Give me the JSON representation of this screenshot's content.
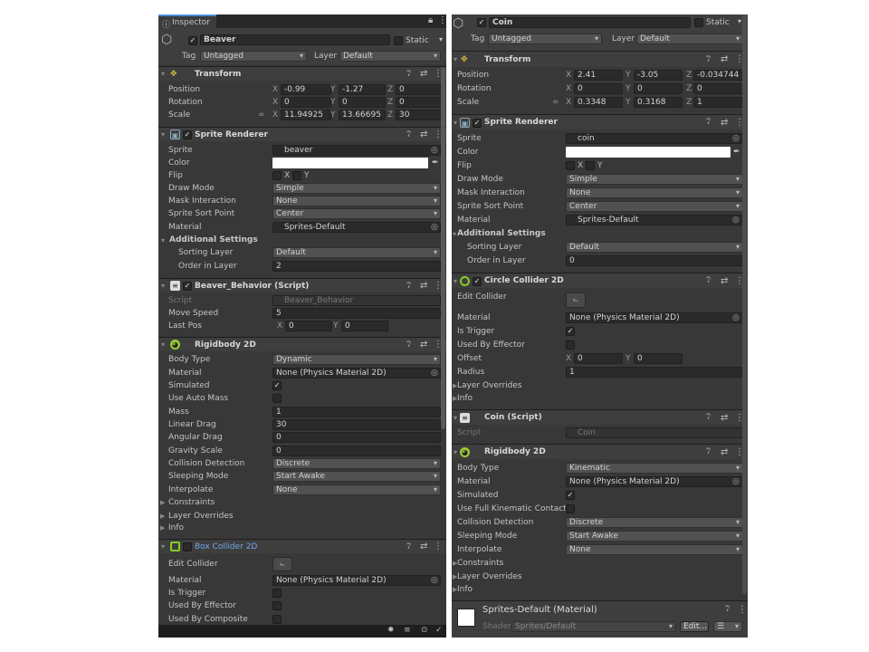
{
  "left": {
    "tab": "Inspector",
    "object": {
      "name": "Beaver",
      "static": "Static",
      "tag_label": "Tag",
      "tag": "Untagged",
      "layer_label": "Layer",
      "layer": "Default"
    },
    "transform": {
      "title": "Transform",
      "position": "Position",
      "rotation": "Rotation",
      "scale": "Scale",
      "px": "-0.99",
      "py": "-1.27",
      "pz": "0",
      "rx": "0",
      "ry": "0",
      "rz": "0",
      "sx": "11.94925",
      "sy": "13.66695",
      "sz": "30"
    },
    "sprite_renderer": {
      "title": "Sprite Renderer",
      "sprite_l": "Sprite",
      "sprite": "beaver",
      "color_l": "Color",
      "flip_l": "Flip",
      "draw_l": "Draw Mode",
      "draw": "Simple",
      "mask_l": "Mask Interaction",
      "mask": "None",
      "sort_l": "Sprite Sort Point",
      "sort": "Center",
      "mat_l": "Material",
      "mat": "Sprites-Default",
      "add_l": "Additional Settings",
      "slayer_l": "Sorting Layer",
      "slayer": "Default",
      "order_l": "Order in Layer",
      "order": "2"
    },
    "script": {
      "title": "Beaver_Behavior (Script)",
      "script_l": "Script",
      "script": "Beaver_Behavior",
      "speed_l": "Move Speed",
      "speed": "5",
      "last_l": "Last Pos",
      "lx": "0",
      "ly": "0"
    },
    "rigidbody": {
      "title": "Rigidbody 2D",
      "body_l": "Body Type",
      "body": "Dynamic",
      "mat_l": "Material",
      "mat": "None (Physics Material 2D)",
      "sim_l": "Simulated",
      "auto_l": "Use Auto Mass",
      "mass_l": "Mass",
      "mass": "1",
      "ldrag_l": "Linear Drag",
      "ldrag": "30",
      "adrag_l": "Angular Drag",
      "adrag": "0",
      "grav_l": "Gravity Scale",
      "grav": "0",
      "coll_l": "Collision Detection",
      "coll": "Discrete",
      "sleep_l": "Sleeping Mode",
      "sleep": "Start Awake",
      "interp_l": "Interpolate",
      "interp": "None",
      "cons_l": "Constraints",
      "lo_l": "Layer Overrides",
      "info_l": "Info"
    },
    "box": {
      "title": "Box Collider 2D",
      "edit_l": "Edit Collider",
      "mat_l": "Material",
      "mat": "None (Physics Material 2D)",
      "trig_l": "Is Trigger",
      "eff_l": "Used By Effector",
      "comp_l": "Used By Composite"
    }
  },
  "right": {
    "object": {
      "name": "Coin",
      "static": "Static",
      "tag_label": "Tag",
      "tag": "Untagged",
      "layer_label": "Layer",
      "layer": "Default"
    },
    "transform": {
      "title": "Transform",
      "position": "Position",
      "rotation": "Rotation",
      "scale": "Scale",
      "px": "2.41",
      "py": "-3.05",
      "pz": "-0.034744",
      "rx": "0",
      "ry": "0",
      "rz": "0",
      "sx": "0.3348",
      "sy": "0.3168",
      "sz": "1"
    },
    "sprite_renderer": {
      "title": "Sprite Renderer",
      "sprite_l": "Sprite",
      "sprite": "coin",
      "color_l": "Color",
      "flip_l": "Flip",
      "draw_l": "Draw Mode",
      "draw": "Simple",
      "mask_l": "Mask Interaction",
      "mask": "None",
      "sort_l": "Sprite Sort Point",
      "sort": "Center",
      "mat_l": "Material",
      "mat": "Sprites-Default",
      "add_l": "Additional Settings",
      "slayer_l": "Sorting Layer",
      "slayer": "Default",
      "order_l": "Order in Layer",
      "order": "0"
    },
    "circle": {
      "title": "Circle Collider 2D",
      "edit_l": "Edit Collider",
      "mat_l": "Material",
      "mat": "None (Physics Material 2D)",
      "trig_l": "Is Trigger",
      "eff_l": "Used By Effector",
      "off_l": "Offset",
      "ox": "0",
      "oy": "0",
      "rad_l": "Radius",
      "rad": "1",
      "lo_l": "Layer Overrides",
      "info_l": "Info"
    },
    "script": {
      "title": "Coin (Script)",
      "script_l": "Script",
      "script": "Coin"
    },
    "rigidbody": {
      "title": "Rigidbody 2D",
      "body_l": "Body Type",
      "body": "Kinematic",
      "mat_l": "Material",
      "mat": "None (Physics Material 2D)",
      "sim_l": "Simulated",
      "full_l": "Use Full Kinematic Contacts",
      "coll_l": "Collision Detection",
      "coll": "Discrete",
      "sleep_l": "Sleeping Mode",
      "sleep": "Start Awake",
      "interp_l": "Interpolate",
      "interp": "None",
      "cons_l": "Constraints",
      "lo_l": "Layer Overrides",
      "info_l": "Info"
    },
    "material": {
      "title": "Sprites-Default (Material)",
      "shader_l": "Shader",
      "shader": "Sprites/Default",
      "edit": "Edit..."
    }
  },
  "labels": {
    "x": "X",
    "y": "Y",
    "z": "Z"
  }
}
